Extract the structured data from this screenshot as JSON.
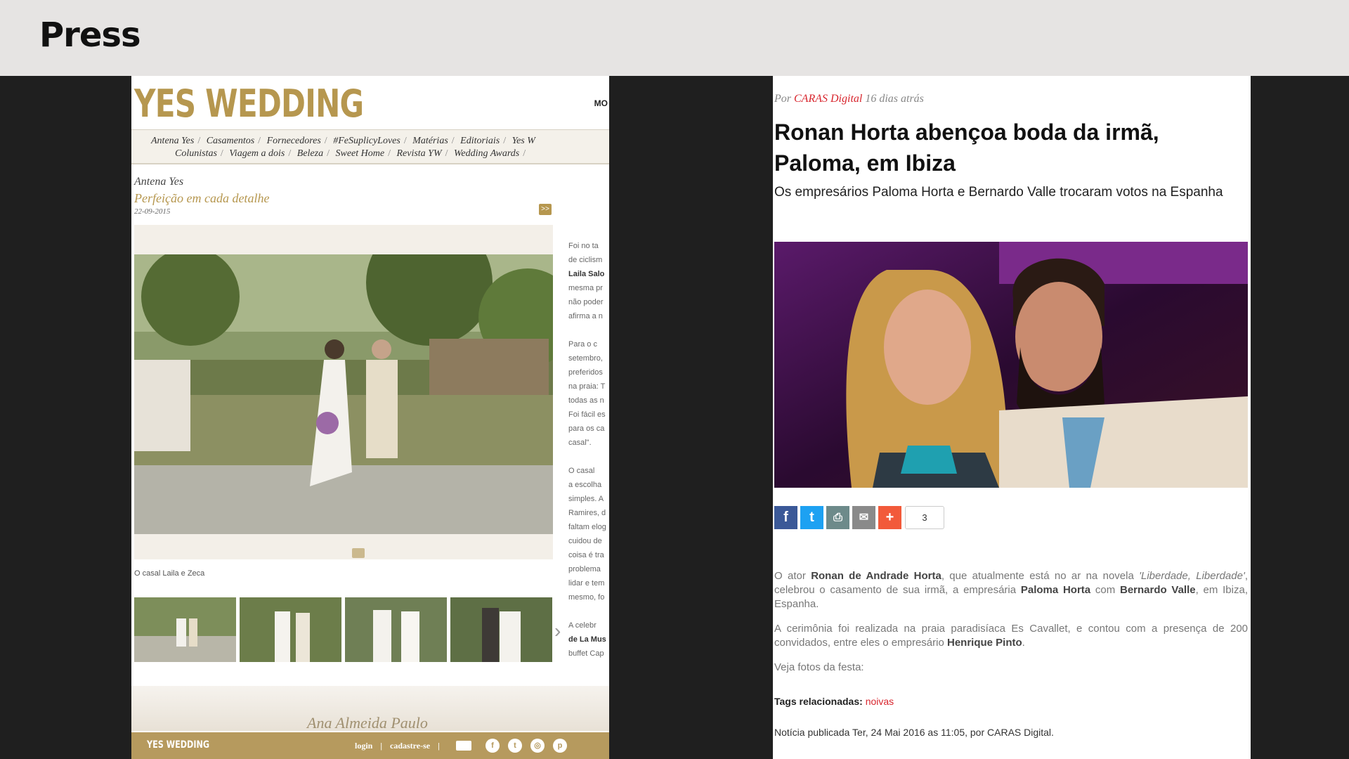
{
  "header": {
    "title": "Press"
  },
  "yes_wedding": {
    "logo": "YES WEDDING",
    "more": "MO",
    "nav_row1": [
      "Antena Yes",
      "Casamentos",
      "Fornecedores",
      "#FeSuplicyLoves",
      "Matérias",
      "Editoriais",
      "Yes W"
    ],
    "nav_row2": [
      "Colunistas",
      "Viagem a dois",
      "Beleza",
      "Sweet Home",
      "Revista YW",
      "Wedding Awards",
      "/"
    ],
    "section": "Antena Yes",
    "article_title": "Perfeição em cada detalhe",
    "date": "22-09-2015",
    "caption": "O casal Laila e Zeca",
    "side_column": [
      [
        "Foi no ta",
        "de ciclism",
        "Laila Salo",
        "mesma pr",
        "não poder",
        "afirma a n"
      ],
      [
        "Para o c",
        "setembro,",
        "preferidos",
        "na praia: T",
        "todas as n",
        "Foi fácil es",
        "para os ca",
        "casal\"."
      ],
      [
        "O casal",
        "a escolha",
        "simples. A",
        "Ramires, d",
        "faltam elog",
        "cuidou de",
        "coisa é tra",
        "problema",
        "lidar e tem",
        "mesmo, fo"
      ],
      [
        "A celebr",
        "de La Mus",
        "buffet Cap"
      ]
    ],
    "banner_text": "Ana Almeida Paulo",
    "footer": {
      "brand": "YES WEDDING",
      "login": "login",
      "register": "cadastre-se"
    },
    "colors": {
      "gold": "#b6974f"
    }
  },
  "caras": {
    "by_prefix": "Por",
    "source": "CARAS Digital",
    "time_ago": "16 dias atrás",
    "title": "Ronan Horta abençoa boda da irmã, Paloma, em Ibiza",
    "subtitle": "Os empresários Paloma Horta e Bernardo Valle trocaram votos na Espanha",
    "share_count": "3",
    "body": {
      "p1_a": "O ator ",
      "p1_actor": "Ronan de Andrade Horta",
      "p1_b": ", que atualmente está no ar na novela ",
      "p1_show": "'Liberdade, Liberdade'",
      "p1_c": ", celebrou o casamento de sua irmã, a empresária ",
      "p1_bride": "Paloma Horta",
      "p1_d": " com ",
      "p1_groom": "Bernardo Valle",
      "p1_e": ", em Ibiza, Espanha.",
      "p2_a": "A cerimônia foi realizada na praia paradisíaca Es Cavallet, e contou com a presença de 200 convidados, entre eles o empresário ",
      "p2_guest": "Henrique Pinto",
      "p2_b": ".",
      "p3": "Veja fotos da festa:"
    },
    "tags_label": "Tags relacionadas:",
    "tag": "noivas",
    "published": "Notícia publicada Ter, 24 Mai 2016 as 11:05, por CARAS Digital.",
    "colors": {
      "accent": "#d8262e"
    }
  }
}
